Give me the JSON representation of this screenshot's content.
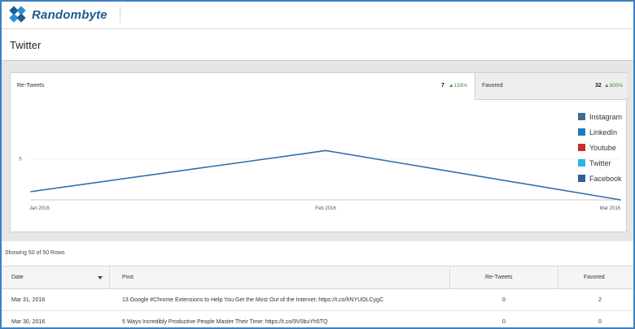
{
  "app": {
    "name": "Randombyte"
  },
  "page": {
    "title": "Twitter"
  },
  "tabs": [
    {
      "label": "Re-Tweets",
      "value": "7",
      "delta": "▲133%"
    },
    {
      "label": "Favored",
      "value": "32",
      "delta": "▲300%"
    }
  ],
  "legend": [
    {
      "label": "Instagram",
      "color": "#3d6e93"
    },
    {
      "label": "LinkedIn",
      "color": "#1f7bbf"
    },
    {
      "label": "Youtube",
      "color": "#cc2b2b"
    },
    {
      "label": "Twitter",
      "color": "#29b6ea"
    },
    {
      "label": "Facebook",
      "color": "#3a5a9a"
    }
  ],
  "chart_data": {
    "type": "line",
    "categories": [
      "Jan 2016",
      "Feb 2016",
      "Mar 2016"
    ],
    "series": [
      {
        "name": "Twitter",
        "values": [
          1,
          6,
          0
        ],
        "color": "#2a6fb0"
      }
    ],
    "y_ticks": [
      "5"
    ],
    "ylim": [
      0,
      9.5
    ]
  },
  "table": {
    "row_count_text": "Showing 50 of 50 Rows",
    "columns": [
      "Date",
      "Post",
      "Re-Tweets",
      "Favored"
    ],
    "rows": [
      {
        "date": "Mar 31, 2016",
        "post": "13 Google #Chrome Extensions to Help You Get the Most Out of the Internet: https://t.co/hNYUOLCygC",
        "retweets": "0",
        "favored": "2"
      },
      {
        "date": "Mar 30, 2016",
        "post": "5 Ways Incredibly Productive People Master Their Time: https://t.co/9V0buYh5TQ",
        "retweets": "0",
        "favored": "0"
      }
    ]
  }
}
